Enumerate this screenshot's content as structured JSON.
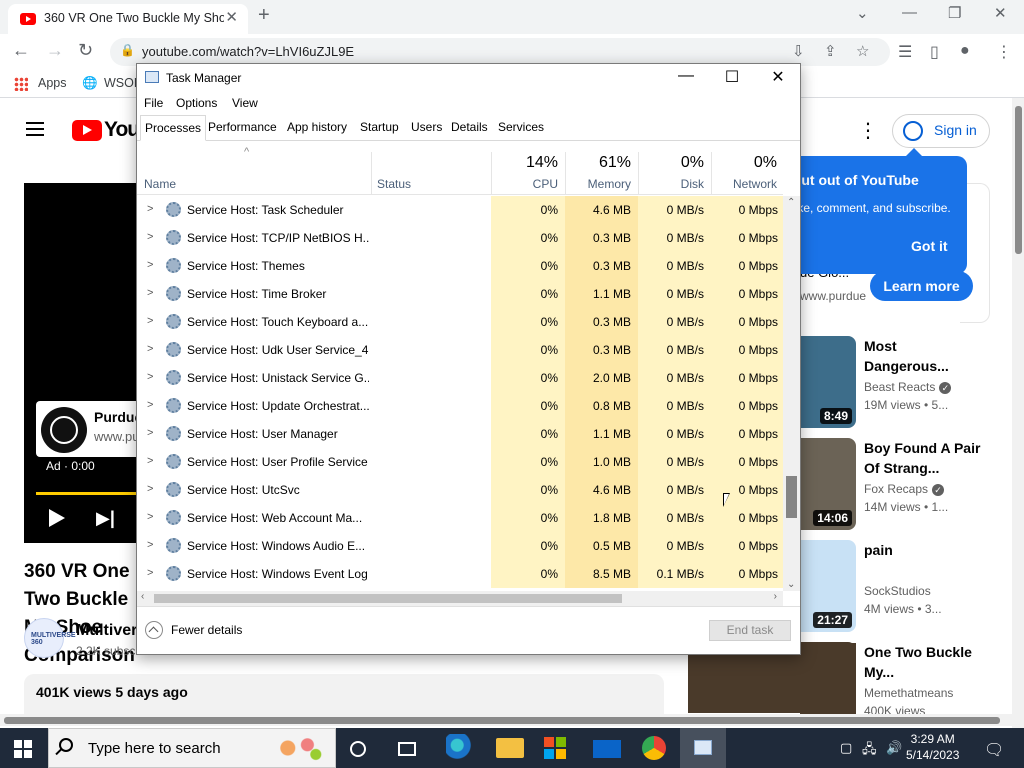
{
  "browser": {
    "tab_title": "360 VR One Two Buckle My Shoe",
    "url": "youtube.com/watch?v=LhVI6uZJL9E",
    "bookmarks": [
      "Apps",
      "WSOD"
    ]
  },
  "youtube": {
    "logo_text": "YouTube",
    "signin_label": "Sign in",
    "ad": {
      "name": "Purdue",
      "url": "www.pu",
      "time": "Ad · 0:00",
      "side_url": "www.purdue",
      "side_partial": "ue Glo..."
    },
    "tooltip": {
      "title": "Put out of YouTube",
      "body": "Like, comment, and subscribe.",
      "got_it": "Got it"
    },
    "learn_more": "Learn more",
    "video_title": "360 VR One Two Buckle My Shoe Comparison",
    "channel_name": "Multiverse",
    "channel_subs": "2.2K subscribers",
    "channel_avatar_text": "MULTIVERSE 360",
    "desc_stats": "401K views  5 days ago",
    "recommended": [
      {
        "title": "Most Dangerous...",
        "channel": "Beast Reacts",
        "meta": "19M views • 5...",
        "duration": "8:49",
        "color": "#3d6d8a"
      },
      {
        "title": "Boy Found A Pair Of Strang...",
        "channel": "Fox Recaps",
        "meta": "14M views • 1...",
        "duration": "14:06",
        "color": "#6b6356"
      },
      {
        "title": "pain",
        "channel": "SockStudios",
        "meta": "4M views • 3...",
        "duration": "21:27",
        "color": "#c8e1f5"
      },
      {
        "title": "One Two Buckle My...",
        "channel": "Memethatmeans",
        "meta": "400K views",
        "duration": "",
        "color": "#4a3a2a"
      }
    ]
  },
  "taskmanager": {
    "title": "Task Manager",
    "menus": [
      "File",
      "Options",
      "View"
    ],
    "tabs": [
      "Processes",
      "Performance",
      "App history",
      "Startup",
      "Users",
      "Details",
      "Services"
    ],
    "columns": {
      "name": "Name",
      "status": "Status",
      "cpu_pct": "14%",
      "cpu": "CPU",
      "mem_pct": "61%",
      "mem": "Memory",
      "disk_pct": "0%",
      "disk": "Disk",
      "net_pct": "0%",
      "net": "Network"
    },
    "rows": [
      {
        "name": "Service Host: Task Scheduler",
        "cpu": "0%",
        "mem": "4.6 MB",
        "disk": "0 MB/s",
        "net": "0 Mbps"
      },
      {
        "name": "Service Host: TCP/IP NetBIOS H...",
        "cpu": "0%",
        "mem": "0.3 MB",
        "disk": "0 MB/s",
        "net": "0 Mbps"
      },
      {
        "name": "Service Host: Themes",
        "cpu": "0%",
        "mem": "0.3 MB",
        "disk": "0 MB/s",
        "net": "0 Mbps"
      },
      {
        "name": "Service Host: Time Broker",
        "cpu": "0%",
        "mem": "1.1 MB",
        "disk": "0 MB/s",
        "net": "0 Mbps"
      },
      {
        "name": "Service Host: Touch Keyboard a...",
        "cpu": "0%",
        "mem": "0.3 MB",
        "disk": "0 MB/s",
        "net": "0 Mbps"
      },
      {
        "name": "Service Host: Udk User Service_4...",
        "cpu": "0%",
        "mem": "0.3 MB",
        "disk": "0 MB/s",
        "net": "0 Mbps"
      },
      {
        "name": "Service Host: Unistack Service G...",
        "cpu": "0%",
        "mem": "2.0 MB",
        "disk": "0 MB/s",
        "net": "0 Mbps"
      },
      {
        "name": "Service Host: Update Orchestrat...",
        "cpu": "0%",
        "mem": "0.8 MB",
        "disk": "0 MB/s",
        "net": "0 Mbps"
      },
      {
        "name": "Service Host: User Manager",
        "cpu": "0%",
        "mem": "1.1 MB",
        "disk": "0 MB/s",
        "net": "0 Mbps"
      },
      {
        "name": "Service Host: User Profile Service",
        "cpu": "0%",
        "mem": "1.0 MB",
        "disk": "0 MB/s",
        "net": "0 Mbps"
      },
      {
        "name": "Service Host: UtcSvc",
        "cpu": "0%",
        "mem": "4.6 MB",
        "disk": "0 MB/s",
        "net": "0 Mbps"
      },
      {
        "name": "Service Host: Web Account Ma...",
        "cpu": "0%",
        "mem": "1.8 MB",
        "disk": "0 MB/s",
        "net": "0 Mbps"
      },
      {
        "name": "Service Host: Windows Audio E...",
        "cpu": "0%",
        "mem": "0.5 MB",
        "disk": "0 MB/s",
        "net": "0 Mbps"
      },
      {
        "name": "Service Host: Windows Event Log",
        "cpu": "0%",
        "mem": "8.5 MB",
        "disk": "0.1 MB/s",
        "net": "0 Mbps"
      }
    ],
    "fewer_details": "Fewer details",
    "end_task": "End task"
  },
  "taskbar": {
    "search_placeholder": "Type here to search",
    "time": "3:29 AM",
    "date": "5/14/2023"
  }
}
